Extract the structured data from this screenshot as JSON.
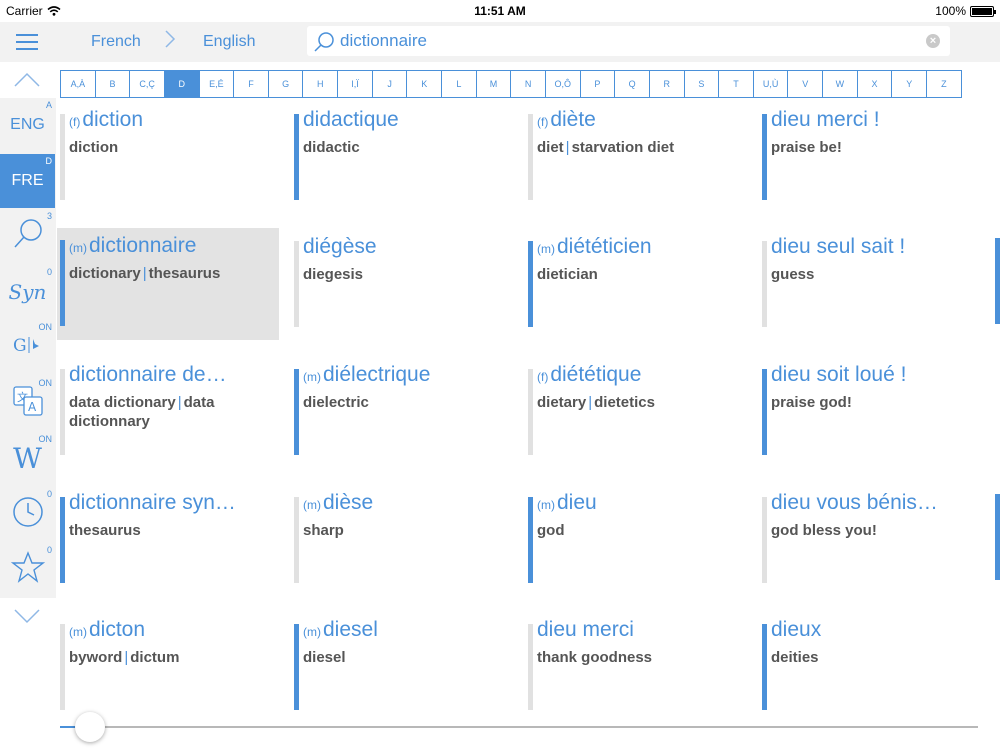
{
  "status": {
    "carrier": "Carrier",
    "time": "11:51 AM",
    "battery": "100%",
    "battery_level": 1.0
  },
  "nav": {
    "lang_from": "French",
    "lang_to": "English",
    "search_value": "dictionnaire",
    "menu_icon": "hamburger-icon"
  },
  "alphabet": {
    "active": "D",
    "letters": [
      "A,À",
      "B",
      "C,Ç",
      "D",
      "E,É",
      "F",
      "G",
      "H",
      "I,Ï",
      "J",
      "K",
      "L",
      "M",
      "N",
      "O,Ô",
      "P",
      "Q",
      "R",
      "S",
      "T",
      "U,Ù",
      "V",
      "W",
      "X",
      "Y",
      "Z"
    ]
  },
  "sidebar": [
    {
      "label": "ENG",
      "badge": "A",
      "active": false,
      "icon": "text"
    },
    {
      "label": "FRE",
      "badge": "D",
      "active": true,
      "icon": "text"
    },
    {
      "label": "",
      "badge": "3",
      "active": false,
      "icon": "search-icon"
    },
    {
      "label": "Syn",
      "badge": "0",
      "active": false,
      "icon": "synonyms-icon"
    },
    {
      "label": "",
      "badge": "ON",
      "active": false,
      "icon": "google-bing-icon"
    },
    {
      "label": "",
      "badge": "ON",
      "active": false,
      "icon": "translate-icon"
    },
    {
      "label": "",
      "badge": "ON",
      "active": false,
      "icon": "wikipedia-icon"
    },
    {
      "label": "",
      "badge": "0",
      "active": false,
      "icon": "history-icon"
    },
    {
      "label": "",
      "badge": "0",
      "active": false,
      "icon": "star-icon"
    }
  ],
  "entries": [
    {
      "gender": "(f)",
      "word": "diction",
      "trans": [
        "diction"
      ],
      "bar": "gray"
    },
    {
      "gender": "",
      "word": "didactique",
      "trans": [
        "didactic"
      ],
      "bar": "blue"
    },
    {
      "gender": "(f)",
      "word": "diète",
      "trans": [
        "diet",
        "starvation diet"
      ],
      "bar": "gray"
    },
    {
      "gender": "",
      "word": "dieu merci !",
      "trans": [
        "praise be!"
      ],
      "bar": "blue"
    },
    {
      "gender": "(m)",
      "word": "dictionnaire",
      "trans": [
        "dictionary",
        "thesaurus"
      ],
      "bar": "blue",
      "selected": true
    },
    {
      "gender": "",
      "word": "diégèse",
      "trans": [
        "diegesis"
      ],
      "bar": "gray"
    },
    {
      "gender": "(m)",
      "word": "diététicien",
      "trans": [
        "dietician"
      ],
      "bar": "blue"
    },
    {
      "gender": "",
      "word": "dieu seul sait !",
      "trans": [
        "guess"
      ],
      "bar": "gray"
    },
    {
      "gender": "",
      "word": "dictionnaire de…",
      "trans": [
        "data dictionary",
        "data dictionnary"
      ],
      "bar": "gray"
    },
    {
      "gender": "(m)",
      "word": "diélectrique",
      "trans": [
        "dielectric"
      ],
      "bar": "blue"
    },
    {
      "gender": "(f)",
      "word": "diététique",
      "trans": [
        "dietary",
        "dietetics"
      ],
      "bar": "gray"
    },
    {
      "gender": "",
      "word": "dieu soit loué !",
      "trans": [
        "praise god!"
      ],
      "bar": "blue"
    },
    {
      "gender": "",
      "word": "dictionnaire syn…",
      "trans": [
        "thesaurus"
      ],
      "bar": "blue"
    },
    {
      "gender": "(m)",
      "word": "dièse",
      "trans": [
        "sharp"
      ],
      "bar": "gray"
    },
    {
      "gender": "(m)",
      "word": "dieu",
      "trans": [
        "god"
      ],
      "bar": "blue"
    },
    {
      "gender": "",
      "word": "dieu vous bénis…",
      "trans": [
        "god bless you!"
      ],
      "bar": "gray"
    },
    {
      "gender": "(m)",
      "word": "dicton",
      "trans": [
        "byword",
        "dictum"
      ],
      "bar": "gray"
    },
    {
      "gender": "(m)",
      "word": "diesel",
      "trans": [
        "diesel"
      ],
      "bar": "blue"
    },
    {
      "gender": "",
      "word": "dieu merci",
      "trans": [
        "thank goodness"
      ],
      "bar": "gray"
    },
    {
      "gender": "",
      "word": "dieux",
      "trans": [
        "deities"
      ],
      "bar": "blue"
    }
  ],
  "slider": {
    "value": 0.0
  },
  "colors": {
    "accent": "#4a90d9",
    "selected_bg": "#e3e3e3",
    "bar_gray": "#e1e1e1"
  }
}
